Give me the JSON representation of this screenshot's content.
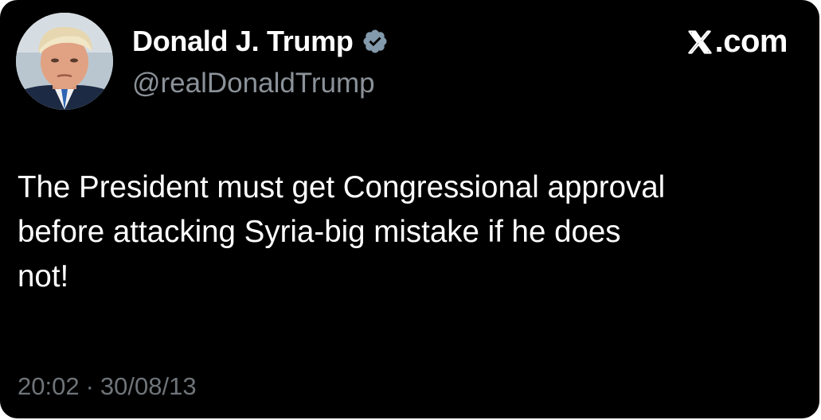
{
  "author": {
    "display_name": "Donald J. Trump",
    "handle": "@realDonaldTrump",
    "verified": true,
    "verified_color": "#829aab"
  },
  "brand": {
    "label": ".com",
    "logo_icon": "x-logo-icon"
  },
  "tweet": {
    "text": "The President must get Congressional approval\nbefore attacking Syria-big mistake if he does\nnot!"
  },
  "meta": {
    "time": "20:02",
    "separator": "·",
    "date": "30/08/13"
  },
  "colors": {
    "background": "#000000",
    "text": "#ffffff",
    "handle": "#8b9299",
    "meta": "#6e7479"
  }
}
